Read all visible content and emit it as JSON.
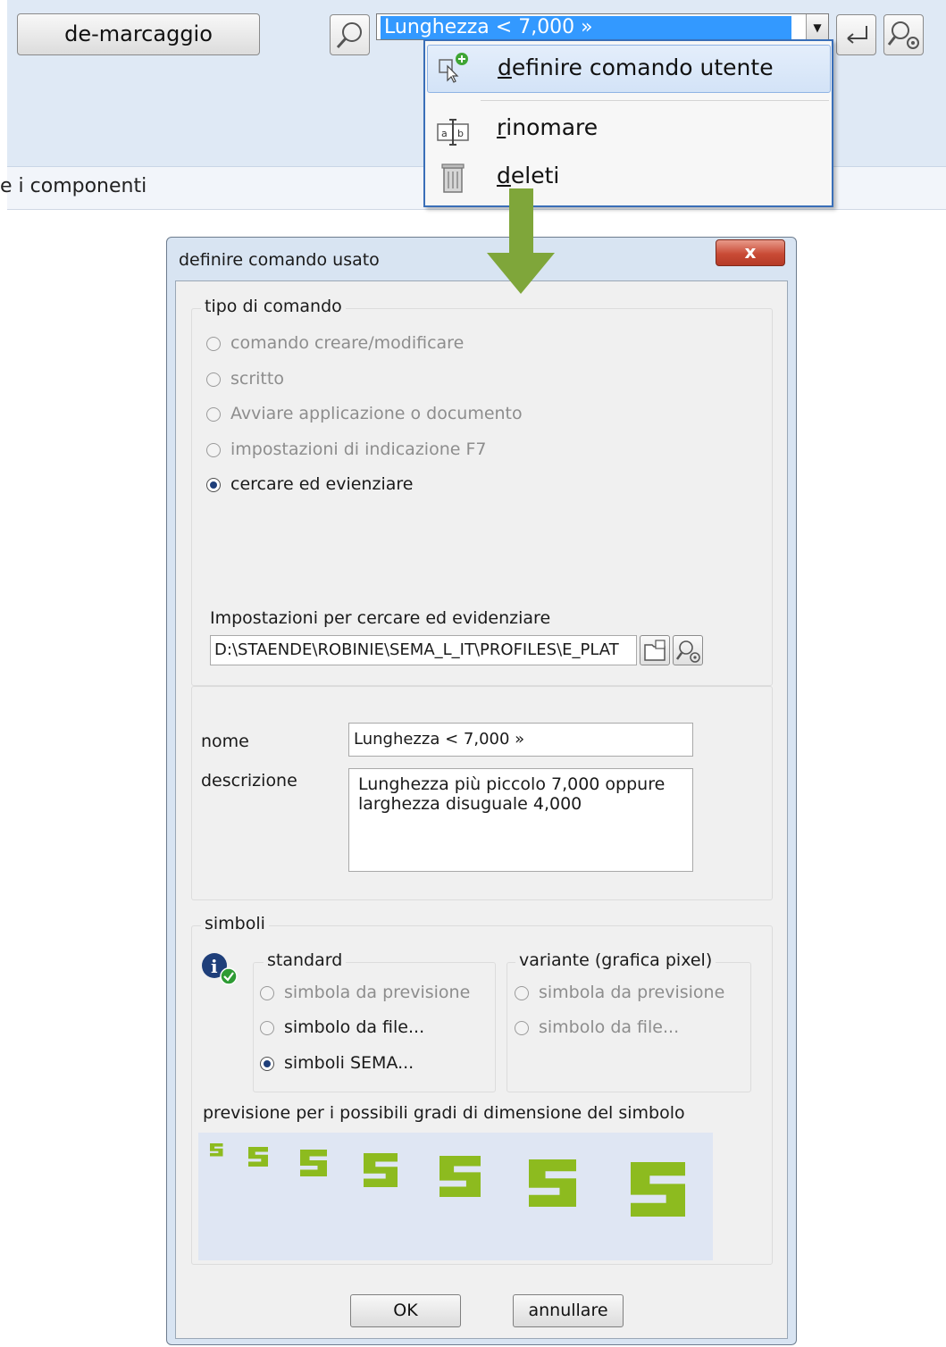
{
  "toolbar": {
    "demark_label": "de-marcaggio",
    "combo_value": "Lunghezza <  7,000 »",
    "status_text": "e i componenti"
  },
  "menu": {
    "items": [
      {
        "label_ul": "d",
        "label_rest": "efinire comando utente",
        "icon": "add-user-command-icon"
      },
      {
        "label_ul": "r",
        "label_rest": "inomare",
        "icon": "rename-icon"
      },
      {
        "label_ul": "d",
        "label_rest": "eleti",
        "icon": "trash-icon"
      }
    ]
  },
  "dialog": {
    "title": "definire comando usato",
    "close_label": "x",
    "command_type": {
      "legend": "tipo di comando",
      "options": [
        {
          "label": "comando creare/modificare",
          "selected": false,
          "enabled": false
        },
        {
          "label": "scritto",
          "selected": false,
          "enabled": false
        },
        {
          "label": "Avviare applicazione o documento",
          "selected": false,
          "enabled": false
        },
        {
          "label": "impostazioni di indicazione F7",
          "selected": false,
          "enabled": false
        },
        {
          "label": "cercare ed evienziare",
          "selected": true,
          "enabled": true
        }
      ],
      "settings_label": "Impostazioni per cercare ed evidenziare",
      "settings_path": "D:\\STAENDE\\ROBINIE\\SEMA_L_IT\\PROFILES\\E_PLAT"
    },
    "name_label": "nome",
    "name_value": "Lunghezza <  7,000 »",
    "description_label": "descrizione",
    "description_line1": "Lunghezza più piccolo  7,000 oppure",
    "description_line2": "larghezza disuguale  4,000",
    "symbols": {
      "legend": "simboli",
      "standard": {
        "legend": "standard",
        "options": [
          {
            "label": "simbola da previsione",
            "selected": false,
            "enabled": false
          },
          {
            "label": "simbolo da file...",
            "selected": false,
            "enabled": true
          },
          {
            "label": "simboli SEMA...",
            "selected": true,
            "enabled": true
          }
        ]
      },
      "variant": {
        "legend": "variante (grafica pixel)",
        "options": [
          {
            "label": "simbola da previsione",
            "selected": false,
            "enabled": false
          },
          {
            "label": "simbolo da file...",
            "selected": false,
            "enabled": false
          }
        ]
      },
      "preview_label": "previsione per i possibili gradi di dimensione del simbolo",
      "preview_color": "#8dbb1f"
    },
    "ok_label": "OK",
    "cancel_label": "annullare"
  },
  "colors": {
    "toolbar_bg": "#dfe9f5",
    "selection_blue": "#3399ff",
    "menu_border": "#3a6fb8",
    "arrow_green": "#7fa63a",
    "sema_green": "#8dbb1f"
  }
}
